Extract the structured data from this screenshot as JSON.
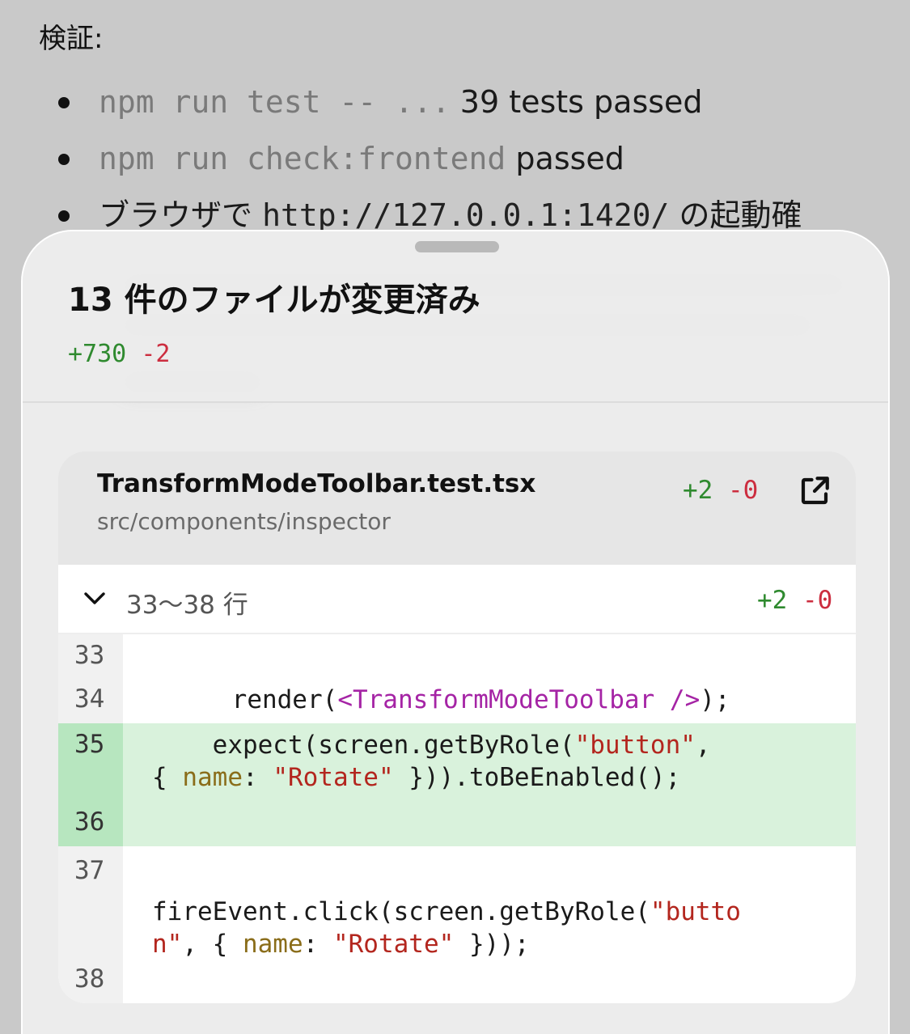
{
  "background": {
    "heading": "検証:",
    "bullets": [
      {
        "code": "npm run test -- ...",
        "text": " 39 tests passed"
      },
      {
        "code": "npm run check:frontend",
        "text": " passed"
      },
      {
        "prefix": "ブラウザで ",
        "code": "http://127.0.0.1:1420/",
        "suffix": " の起動確"
      }
    ]
  },
  "sheet": {
    "title": "13 件のファイルが変更済み",
    "additions": "+730",
    "deletions": "-2"
  },
  "file": {
    "name": "TransformModeToolbar.test.tsx",
    "path": "src/components/inspector",
    "additions": "+2",
    "deletions": "-0"
  },
  "hunk": {
    "range": "33～38 行",
    "additions": "+2",
    "deletions": "-0",
    "lines": [
      {
        "num": "33",
        "type": "context"
      },
      {
        "num": "34",
        "type": "context"
      },
      {
        "num": "35",
        "type": "added"
      },
      {
        "num": "36",
        "type": "added"
      },
      {
        "num": "37",
        "type": "context"
      },
      {
        "num": "38",
        "type": "context"
      }
    ],
    "code": {
      "l34_a": "    render(",
      "l34_tag": "<TransformModeToolbar />",
      "l34_b": ");",
      "l35_a": "    expect(screen.getByRole(",
      "l35_str1": "\"button\"",
      "l35_b": ",",
      "l35_c": "{ ",
      "l35_prop": "name",
      "l35_d": ": ",
      "l35_str2": "\"Rotate\"",
      "l35_e": " })).toBeEnabled();",
      "l37_a": "fireEvent.click(screen.getByRole(",
      "l37_str1a": "\"butto",
      "l37_str1b": "n\"",
      "l37_b": ", { ",
      "l37_prop": "name",
      "l37_c": ": ",
      "l37_str2": "\"Rotate\"",
      "l37_d": " }));"
    }
  },
  "colors": {
    "addition": "#2f8a2f",
    "deletion": "#cc2d3f",
    "added_line_bg": "#d9f2dc"
  }
}
